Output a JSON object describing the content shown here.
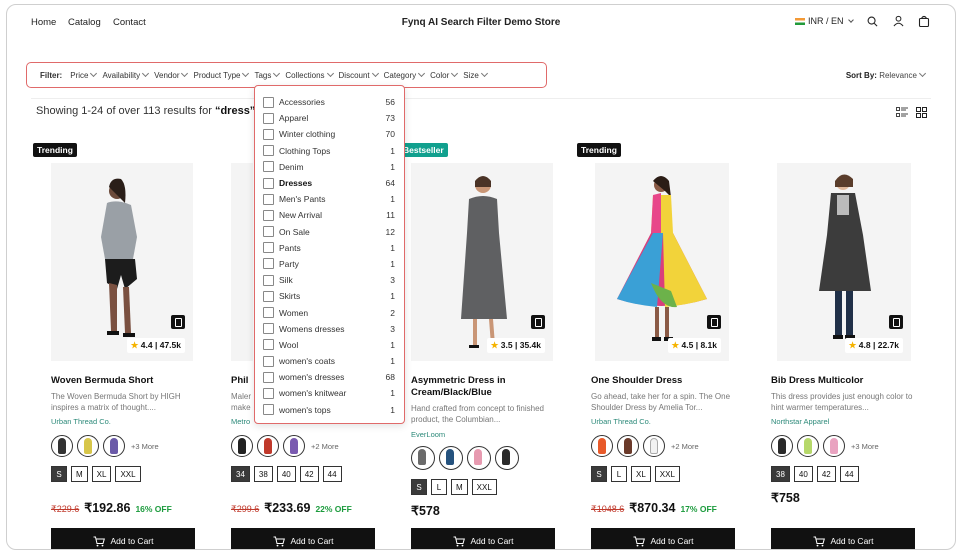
{
  "header": {
    "nav": [
      "Home",
      "Catalog",
      "Contact"
    ],
    "store_title": "Fynq AI Search Filter Demo Store",
    "currency": "INR / EN"
  },
  "filter": {
    "label": "Filter:",
    "items": [
      "Price",
      "Availability",
      "Vendor",
      "Product Type",
      "Tags",
      "Collections",
      "Discount",
      "Category",
      "Color",
      "Size"
    ],
    "sort_label": "Sort By:",
    "sort_value": "Relevance"
  },
  "results": {
    "prefix": "Showing 1-24 of over 113 results for ",
    "query": "“dress”"
  },
  "tags_dropdown": [
    {
      "label": "Accessories",
      "count": "56"
    },
    {
      "label": "Apparel",
      "count": "73"
    },
    {
      "label": "Winter clothing",
      "count": "70"
    },
    {
      "label": "Clothing Tops",
      "count": "1"
    },
    {
      "label": "Denim",
      "count": "1"
    },
    {
      "label": "Dresses",
      "count": "64"
    },
    {
      "label": "Men's Pants",
      "count": "1"
    },
    {
      "label": "New Arrival",
      "count": "11"
    },
    {
      "label": "On Sale",
      "count": "12"
    },
    {
      "label": "Pants",
      "count": "1"
    },
    {
      "label": "Party",
      "count": "1"
    },
    {
      "label": "Silk",
      "count": "3"
    },
    {
      "label": "Skirts",
      "count": "1"
    },
    {
      "label": "Women",
      "count": "2"
    },
    {
      "label": "Womens dresses",
      "count": "3"
    },
    {
      "label": "Wool",
      "count": "1"
    },
    {
      "label": "women's coats",
      "count": "1"
    },
    {
      "label": "women's dresses",
      "count": "68"
    },
    {
      "label": "women's knitwear",
      "count": "1"
    },
    {
      "label": "women's tops",
      "count": "1"
    }
  ],
  "products": [
    {
      "badge": "Trending",
      "rating": "4.4",
      "reviews": "47.5k",
      "name": "Woven Bermuda Short",
      "desc": "The Woven Bermuda Short by HIGH inspires a matrix of thought....",
      "vendor": "Urban Thread Co.",
      "more": "+3 More",
      "sizes": [
        "S",
        "M",
        "XL",
        "XXL"
      ],
      "old": "₹229.6",
      "price": "₹192.86",
      "off": "16% OFF",
      "cart": "Add to Cart"
    },
    {
      "name_partial": "Phil",
      "desc_partial": [
        "Maler",
        "make"
      ],
      "vendor_partial": "Metro",
      "more": "+2 More",
      "sizes": [
        "34",
        "38",
        "40",
        "42",
        "44"
      ],
      "old": "₹299.6",
      "price": "₹233.69",
      "off": "22% OFF",
      "cart": "Add to Cart"
    },
    {
      "badge": "Bestseller",
      "rating": "3.5",
      "reviews": "35.4k",
      "name": "Asymmetric Dress in Cream/Black/Blue",
      "desc": "Hand crafted from concept to finished product, the Columbian...",
      "vendor": "EverLoom",
      "sizes": [
        "S",
        "L",
        "M",
        "XXL"
      ],
      "price": "₹578",
      "cart": "Add to Cart"
    },
    {
      "badge": "Trending",
      "rating": "4.5",
      "reviews": "8.1k",
      "name": "One Shoulder Dress",
      "desc": "Go ahead, take her for a spin. The One Shoulder Dress by Amelia Tor...",
      "vendor": "Urban Thread Co.",
      "more": "+2 More",
      "sizes": [
        "S",
        "L",
        "XL",
        "XXL"
      ],
      "old": "₹1048.6",
      "price": "₹870.34",
      "off": "17% OFF",
      "cart": "Add to Cart"
    },
    {
      "rating": "4.8",
      "reviews": "22.7k",
      "name": "Bib Dress Multicolor",
      "desc": "This dress provides just enough color to hint warmer temperatures...",
      "vendor": "Northstar Apparel",
      "more": "+3 More",
      "sizes": [
        "38",
        "40",
        "42",
        "44"
      ],
      "price": "₹758",
      "cart": "Add to Cart"
    }
  ]
}
